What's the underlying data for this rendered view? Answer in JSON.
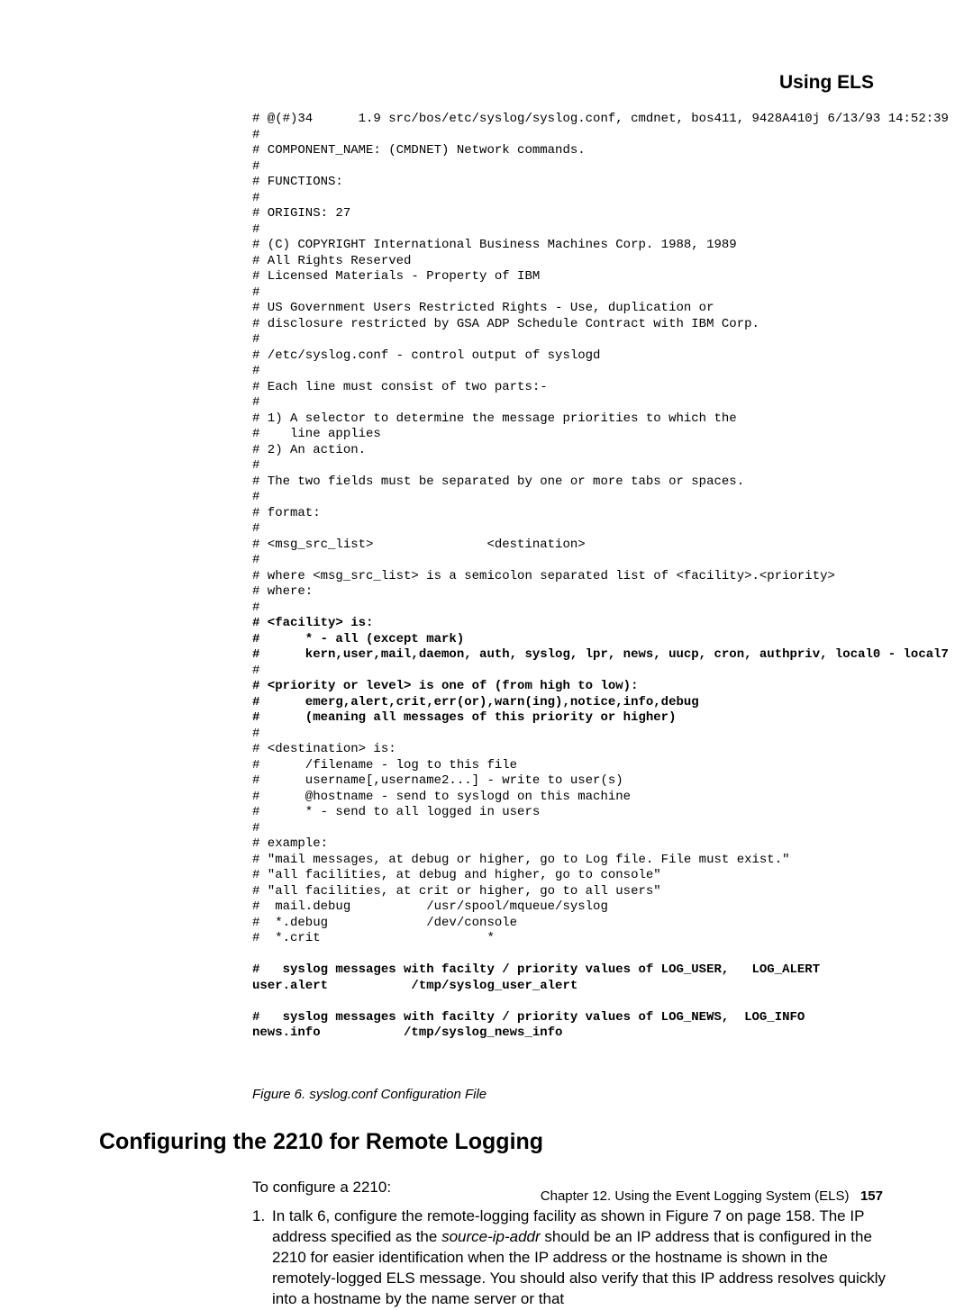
{
  "running_head": "Using ELS",
  "code_plain_1": "# @(#)34      1.9 src/bos/etc/syslog/syslog.conf, cmdnet, bos411, 9428A410j 6/13/93 14:52:39\n#\n# COMPONENT_NAME: (CMDNET) Network commands.\n#\n# FUNCTIONS:\n#\n# ORIGINS: 27\n#\n# (C) COPYRIGHT International Business Machines Corp. 1988, 1989\n# All Rights Reserved\n# Licensed Materials - Property of IBM\n#\n# US Government Users Restricted Rights - Use, duplication or\n# disclosure restricted by GSA ADP Schedule Contract with IBM Corp.\n#\n# /etc/syslog.conf - control output of syslogd\n#\n# Each line must consist of two parts:-\n#\n# 1) A selector to determine the message priorities to which the\n#    line applies\n# 2) An action.\n#\n# The two fields must be separated by one or more tabs or spaces.\n#\n# format:\n#\n# <msg_src_list>               <destination>\n#\n# where <msg_src_list> is a semicolon separated list of <facility>.<priority>\n# where:\n#",
  "code_bold_1": "# <facility> is:\n#      * - all (except mark)\n#      kern,user,mail,daemon, auth, syslog, lpr, news, uucp, cron, authpriv, local0 - local7",
  "code_plain_2": "#",
  "code_bold_2": "# <priority or level> is one of (from high to low):\n#      emerg,alert,crit,err(or),warn(ing),notice,info,debug\n#      (meaning all messages of this priority or higher)",
  "code_plain_3": "#\n# <destination> is:\n#      /filename - log to this file\n#      username[,username2...] - write to user(s)\n#      @hostname - send to syslogd on this machine\n#      * - send to all logged in users\n#\n# example:\n# \"mail messages, at debug or higher, go to Log file. File must exist.\"\n# \"all facilities, at debug and higher, go to console\"\n# \"all facilities, at crit or higher, go to all users\"\n#  mail.debug          /usr/spool/mqueue/syslog\n#  *.debug             /dev/console\n#  *.crit                      *\n",
  "code_bold_3": "#   syslog messages with facilty / priority values of LOG_USER,   LOG_ALERT\nuser.alert           /tmp/syslog_user_alert\n\n#   syslog messages with facilty / priority values of LOG_NEWS,  LOG_INFO\nnews.info           /tmp/syslog_news_info",
  "caption": "Figure 6. syslog.conf Configuration File",
  "section_heading": "Configuring the 2210 for Remote Logging",
  "intro": "To configure a 2210:",
  "list_num": "1.",
  "list_before_i": "In talk 6, configure the remote-logging facility as shown in Figure 7 on page 158. The IP address specified as the ",
  "list_italic": "source-ip-addr",
  "list_after_i": " should be an IP address that is configured in the 2210 for easier identification when the IP address or the hostname is shown in the remotely-logged ELS message. You should also verify that this IP address resolves quickly into a hostname by the name server or that",
  "footer_chapter": "Chapter 12. Using the Event Logging System (ELS)",
  "footer_page": "157"
}
